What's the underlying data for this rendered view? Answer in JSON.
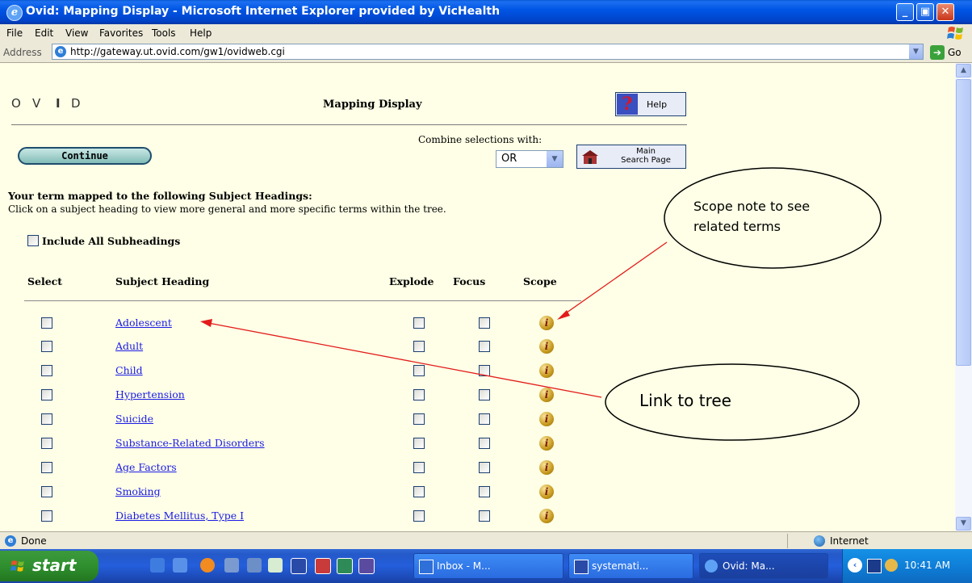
{
  "window": {
    "title": "Ovid: Mapping Display - Microsoft Internet Explorer provided by VicHealth",
    "minimize": "_",
    "maximize": "▣",
    "close": "✕"
  },
  "menu": [
    "File",
    "Edit",
    "View",
    "Favorites",
    "Tools",
    "Help"
  ],
  "address": {
    "label": "Address",
    "url": "http://gateway.ut.ovid.com/gw1/ovidweb.cgi",
    "go_label": "Go"
  },
  "page": {
    "logo_letters": [
      "O",
      "V",
      "I",
      "D"
    ],
    "title": "Mapping Display",
    "help_label": "Help",
    "continue_label": "Continue",
    "combine_label": "Combine selections with:",
    "combine_value": "OR",
    "main_search_label_line1": "Main",
    "main_search_label_line2": "Search Page",
    "heading": "Your term mapped to the following Subject Headings:",
    "instruction": "Click on a subject heading to view more general and more specific terms within the tree.",
    "include_all": "Include All Subheadings",
    "columns": {
      "select": "Select",
      "subject": "Subject Heading",
      "explode": "Explode",
      "focus": "Focus",
      "scope": "Scope"
    },
    "rows": [
      "Adolescent",
      "Adult",
      "Child",
      "Hypertension",
      "Suicide",
      "Substance-Related Disorders",
      "Age Factors",
      "Smoking",
      "Diabetes Mellitus, Type I"
    ]
  },
  "annotations": {
    "scope_note": [
      "Scope note to see",
      "related terms"
    ],
    "link_tree": "Link to tree",
    "arrow_color": "#E31B1B"
  },
  "status": {
    "left": "Done",
    "zone": "Internet"
  },
  "taskbar": {
    "start": "start",
    "buttons": [
      "Inbox - M...",
      "systemati...",
      "Ovid: Ma..."
    ],
    "clock": "10:41 AM"
  }
}
